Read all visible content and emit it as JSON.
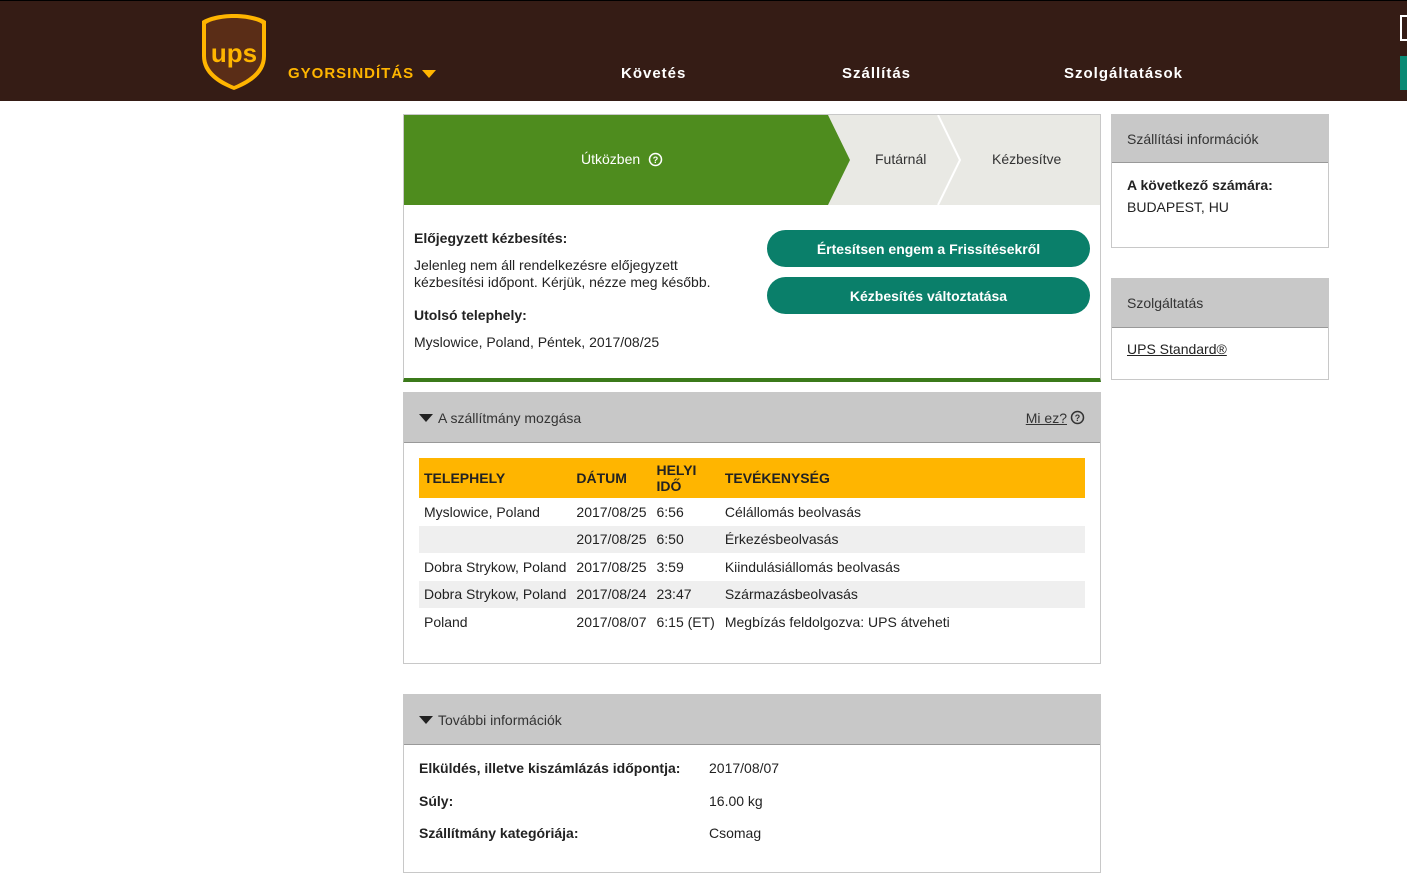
{
  "header": {
    "logo_text": "ups",
    "quick_start": "GYORSINDÍTÁS",
    "nav": [
      "Követés",
      "Szállítás",
      "Szolgáltatások"
    ]
  },
  "status": {
    "steps": [
      "Útközben",
      "Futárnál",
      "Kézbesítve"
    ],
    "current_step_index": 0,
    "scheduled_label": "Előjegyzett kézbesítés:",
    "scheduled_text": "Jelenleg nem áll rendelkezésre előjegyzett kézbesítési időpont. Kérjük, nézze meg később.",
    "last_location_label": "Utolsó telephely:",
    "last_location_value": "Myslowice, Poland, Péntek, 2017/08/25",
    "btn_notify": "Értesítsen engem a Frissítésekről",
    "btn_change": "Kézbesítés változtatása"
  },
  "side": {
    "shipping_info_title": "Szállítási információk",
    "next_label": "A következő számára:",
    "next_value": "BUDAPEST,  HU",
    "service_title": "Szolgáltatás",
    "service_value": "UPS Standard®"
  },
  "movement": {
    "title": "A szállítmány mozgása",
    "help_link": "Mi ez?",
    "columns": [
      "TELEPHELY",
      "DÁTUM",
      "HELYI IDŐ",
      "TEVÉKENYSÉG"
    ],
    "rows": [
      {
        "location": "Myslowice,  Poland",
        "date": "2017/08/25",
        "time": "6:56",
        "activity": "Célállomás beolvasás"
      },
      {
        "location": "",
        "date": "2017/08/25",
        "time": "6:50",
        "activity": "Érkezésbeolvasás"
      },
      {
        "location": "Dobra Strykow,  Poland",
        "date": "2017/08/25",
        "time": "3:59",
        "activity": "Kiindulásiállomás beolvasás"
      },
      {
        "location": "Dobra Strykow,  Poland",
        "date": "2017/08/24",
        "time": "23:47",
        "activity": "Származásbeolvasás"
      },
      {
        "location": "Poland",
        "date": "2017/08/07",
        "time": "6:15 (ET)",
        "activity": "Megbízás feldolgozva: UPS átveheti"
      }
    ]
  },
  "more": {
    "title": "További információk",
    "rows": [
      {
        "label": "Elküldés, illetve kiszámlázás időpontja:",
        "value": "2017/08/07"
      },
      {
        "label": "Súly:",
        "value": "16.00 kg"
      },
      {
        "label": "Szállítmány kategóriája:",
        "value": "Csomag"
      }
    ]
  },
  "colors": {
    "header_bg": "#351c15",
    "accent_yellow": "#ffb500",
    "progress_green": "#4e8c1e",
    "button_teal": "#0a7f6a"
  }
}
